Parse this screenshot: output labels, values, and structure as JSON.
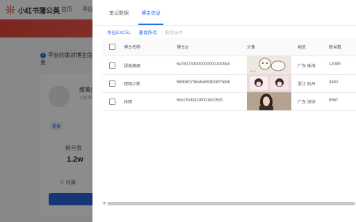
{
  "background": {
    "brand": "小红书蒲公英",
    "nav": [
      "首页",
      "寻找"
    ],
    "notice": "平台约束对博主信息",
    "profile": {
      "name": "甜美(",
      "uid": "小红书",
      "tag": "美食",
      "fans_label": "粉丝数",
      "fans_value": "1.2w",
      "favorite_label": "收藏"
    }
  },
  "drawer": {
    "tabs": [
      "笔记数据",
      "博主信息"
    ],
    "active_tab": "博主信息",
    "toolbar": {
      "export": "导出EXCEL",
      "delete_all": "删除所有",
      "delete_selected": "删除选中"
    },
    "columns": [
      "博主名称",
      "博主id",
      "头像",
      "地区",
      "粉丝数"
    ],
    "rows": [
      {
        "name": "甜美庚庚",
        "id": "5e7817330000000001000b4",
        "region": "广东 珠海",
        "fans": "12099"
      },
      {
        "name": "晴明小新",
        "id": "569b80736a6a693b08f7fdd6",
        "region": "浙江 杭州",
        "fans": "3482"
      },
      {
        "name": "林晴",
        "id": "5bccf0cfd119f0016c0530",
        "region": "广东 深圳",
        "fans": "6967"
      }
    ],
    "colors": {
      "accent": "#2f6ee3",
      "brand_red": "#e3443a"
    }
  }
}
